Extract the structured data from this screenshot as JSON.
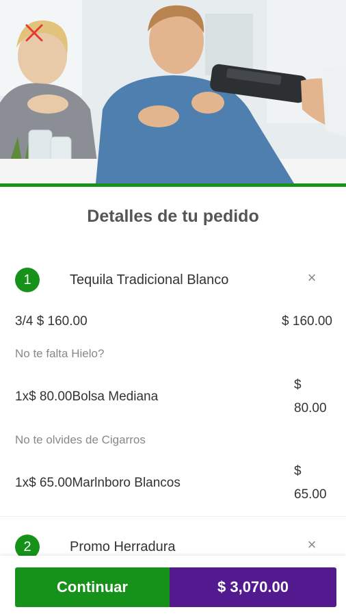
{
  "header": {
    "title": "Detalles de tu pedido",
    "close_icon": "close-icon",
    "accent_color": "#16921a",
    "close_color": "#e53935"
  },
  "items": [
    {
      "number": "1",
      "name": "Tequila Tradicional Blanco",
      "remove": "×",
      "main_line": {
        "text": "3/4 $ 160.00",
        "price": "$ 160.00"
      },
      "extras": [
        {
          "section": "No te falta Hielo?",
          "text": "1x$ 80.00Bolsa Mediana",
          "price_symbol": "$",
          "price_value": "80.00"
        },
        {
          "section": "No te olvides de Cigarros",
          "text": "1x$ 65.00Marlnboro Blancos",
          "price_symbol": "$",
          "price_value": "65.00"
        }
      ]
    },
    {
      "number": "2",
      "name": "Promo Herradura",
      "remove": "×"
    }
  ],
  "footer": {
    "continue_label": "Continuar",
    "total_label": "$ 3,070.00",
    "continue_color": "#16921a",
    "total_color": "#53198f"
  }
}
